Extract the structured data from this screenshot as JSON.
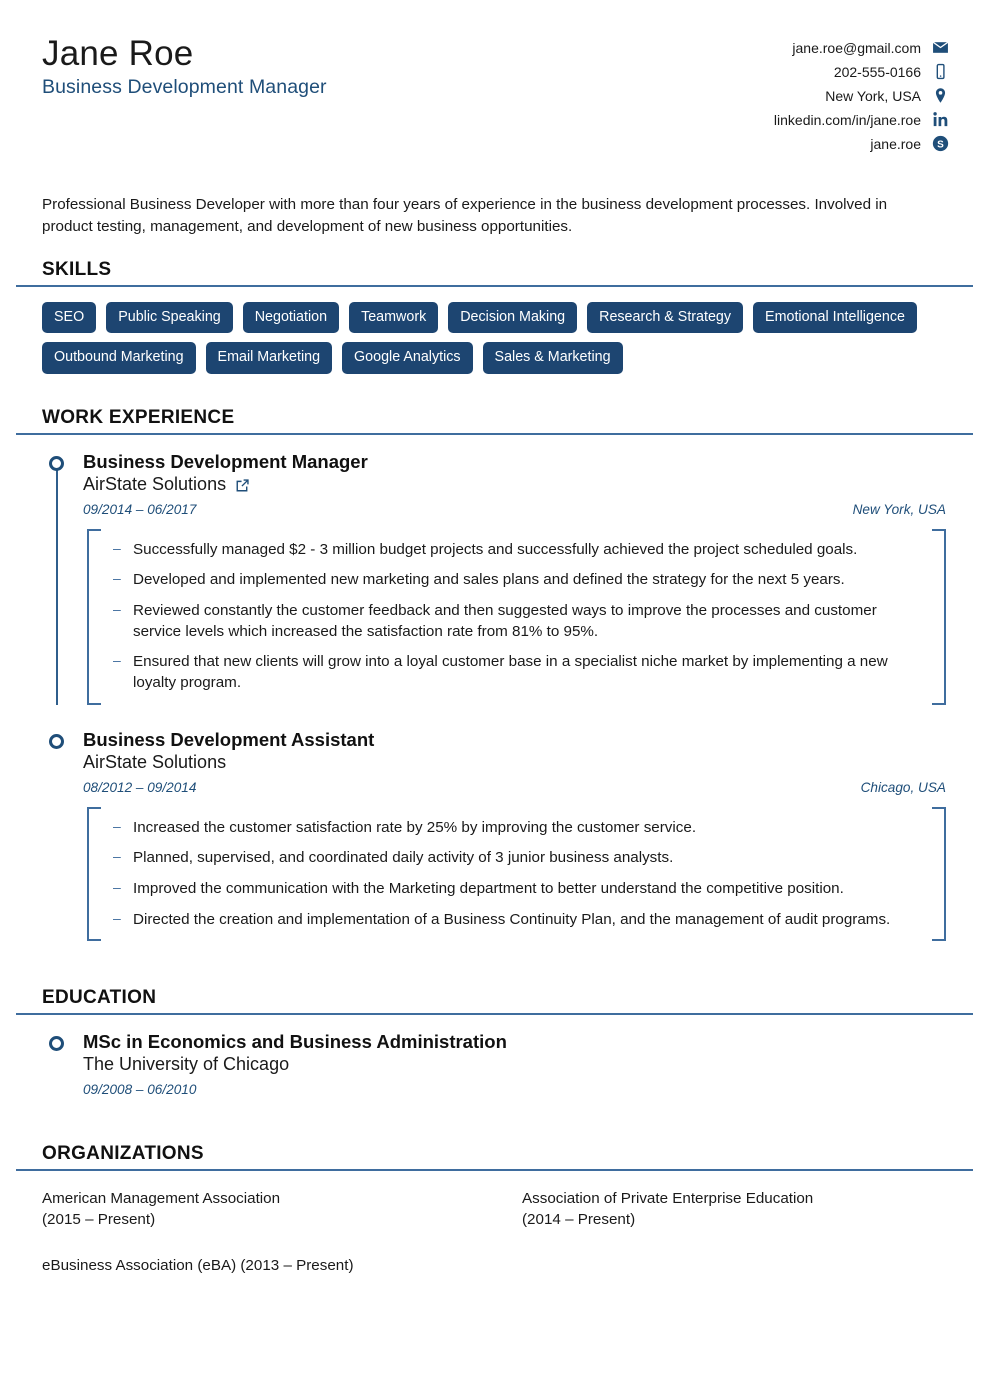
{
  "header": {
    "full_name": "Jane Roe",
    "job_title": "Business Development Manager",
    "contacts": [
      {
        "icon": "envelope-icon",
        "text": "jane.roe@gmail.com"
      },
      {
        "icon": "mobile-phone-icon",
        "text": "202-555-0166"
      },
      {
        "icon": "map-pin-icon",
        "text": "New York, USA"
      },
      {
        "icon": "linkedin-icon",
        "text": "linkedin.com/in/jane.roe"
      },
      {
        "icon": "skype-icon",
        "text": "jane.roe"
      }
    ]
  },
  "summary": "Professional Business Developer with more than four years of experience in the business development processes. Involved in product testing, management, and development of new business opportunities.",
  "sections": {
    "skills_heading": "SKILLS",
    "work_heading": "WORK EXPERIENCE",
    "education_heading": "EDUCATION",
    "organizations_heading": "ORGANIZATIONS"
  },
  "skills": [
    "SEO",
    "Public Speaking",
    "Negotiation",
    "Teamwork",
    "Decision Making",
    "Research & Strategy",
    "Emotional Intelligence",
    "Outbound Marketing",
    "Email Marketing",
    "Google Analytics",
    "Sales & Marketing"
  ],
  "work_experience": [
    {
      "role": "Business Development Manager",
      "company": "AirState Solutions",
      "has_link": true,
      "dates": "09/2014 – 06/2017",
      "location": "New York, USA",
      "bullets": [
        "Successfully managed $2 - 3 million budget projects and successfully achieved the project scheduled goals.",
        "Developed and implemented new marketing and sales plans and defined the strategy for the next 5 years.",
        "Reviewed constantly the customer feedback and then suggested ways to improve the processes and customer service levels which increased the satisfaction rate from 81% to 95%.",
        "Ensured that new clients will grow into a loyal customer base in a specialist niche market by implementing a new loyalty program."
      ]
    },
    {
      "role": "Business Development Assistant",
      "company": "AirState Solutions",
      "has_link": false,
      "dates": "08/2012 – 09/2014",
      "location": "Chicago, USA",
      "bullets": [
        "Increased the customer satisfaction rate by 25% by improving the customer service.",
        "Planned, supervised, and coordinated daily activity of 3 junior business analysts.",
        "Improved the communication with the Marketing department to better understand the competitive position.",
        "Directed the creation and implementation of a Business Continuity Plan, and the management of audit programs."
      ]
    }
  ],
  "education": [
    {
      "degree": "MSc in Economics and Business Administration",
      "school": "The University of Chicago",
      "dates": "09/2008 – 06/2010"
    }
  ],
  "organizations": [
    "American Management Association\n(2015 – Present)",
    "Association of Private Enterprise Education\n(2014 – Present)",
    "eBusiness Association (eBA) (2013 – Present)"
  ],
  "colors": {
    "accent_blue": "#1f4e79",
    "rule_blue": "#3f6d9e",
    "tag_navy": "#1d4571",
    "text_dark": "#1a1a1a"
  }
}
